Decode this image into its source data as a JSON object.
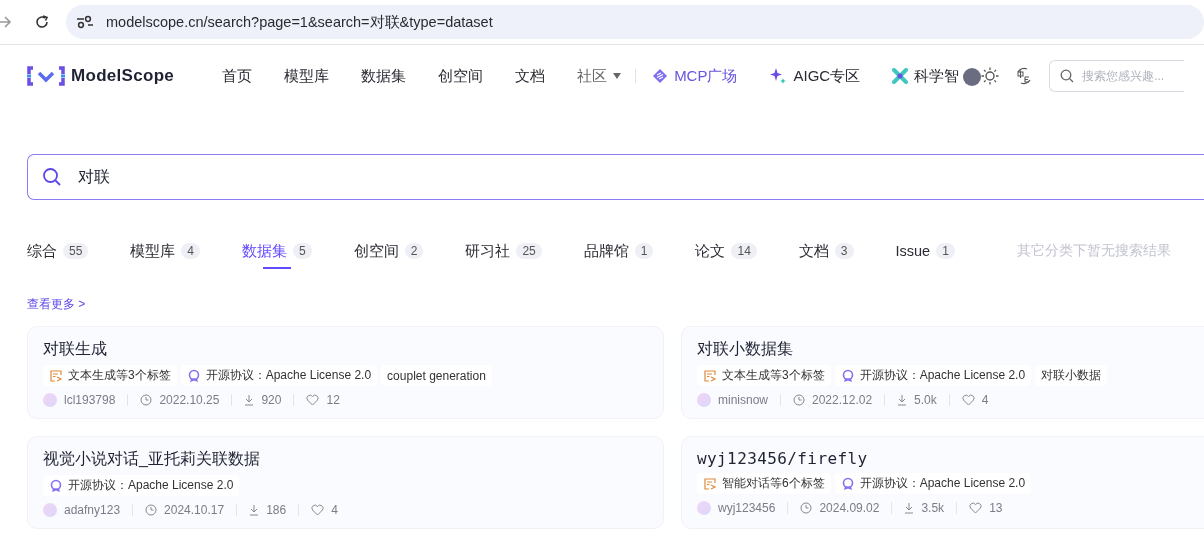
{
  "browser": {
    "url": "modelscope.cn/search?page=1&search=对联&type=dataset"
  },
  "header": {
    "logo": "ModelScope",
    "nav": [
      {
        "label": "首页",
        "kind": "link"
      },
      {
        "label": "模型库",
        "kind": "link"
      },
      {
        "label": "数据集",
        "kind": "link"
      },
      {
        "label": "创空间",
        "kind": "link"
      },
      {
        "label": "文档",
        "kind": "link"
      },
      {
        "label": "社区",
        "kind": "menu"
      },
      {
        "label": "MCP广场",
        "kind": "mcp"
      },
      {
        "label": "AIGC专区",
        "kind": "sparkle"
      },
      {
        "label": "科学智",
        "kind": "science"
      }
    ],
    "search_placeholder": "搜索您感兴趣..."
  },
  "search": {
    "value": "对联"
  },
  "tabs": [
    {
      "label": "综合",
      "count": "55",
      "selected": false
    },
    {
      "label": "模型库",
      "count": "4",
      "selected": false
    },
    {
      "label": "数据集",
      "count": "5",
      "selected": true
    },
    {
      "label": "创空间",
      "count": "2",
      "selected": false
    },
    {
      "label": "研习社",
      "count": "25",
      "selected": false
    },
    {
      "label": "品牌馆",
      "count": "1",
      "selected": false
    },
    {
      "label": "论文",
      "count": "14",
      "selected": false
    },
    {
      "label": "文档",
      "count": "3",
      "selected": false
    },
    {
      "label": "Issue",
      "count": "1",
      "selected": false
    }
  ],
  "no_results_note": "其它分类下暂无搜索结果",
  "more_link": "查看更多 >",
  "cards": [
    {
      "title": "对联生成",
      "monospace": false,
      "tags": [
        {
          "kind": "category",
          "text": "文本生成等3个标签"
        },
        {
          "kind": "license",
          "text": "开源协议：Apache License 2.0"
        },
        {
          "kind": "plain",
          "text": "couplet generation"
        }
      ],
      "author": "lcl193798",
      "date": "2022.10.25",
      "downloads": "920",
      "likes": "12"
    },
    {
      "title": "对联小数据集",
      "monospace": false,
      "tags": [
        {
          "kind": "category",
          "text": "文本生成等3个标签"
        },
        {
          "kind": "license",
          "text": "开源协议：Apache License 2.0"
        },
        {
          "kind": "plain",
          "text": "对联小数据"
        }
      ],
      "author": "minisnow",
      "date": "2022.12.02",
      "downloads": "5.0k",
      "likes": "4"
    },
    {
      "title": "视觉小说对话_亚托莉关联数据",
      "monospace": false,
      "tags": [
        {
          "kind": "license",
          "text": "开源协议：Apache License 2.0"
        }
      ],
      "author": "adafny123",
      "date": "2024.10.17",
      "downloads": "186",
      "likes": "4"
    },
    {
      "title": "wyj123456/firefly",
      "monospace": true,
      "tags": [
        {
          "kind": "category",
          "text": "智能对话等6个标签"
        },
        {
          "kind": "license",
          "text": "开源协议：Apache License 2.0"
        }
      ],
      "author": "wyj123456",
      "date": "2024.09.02",
      "downloads": "3.5k",
      "likes": "13"
    }
  ]
}
